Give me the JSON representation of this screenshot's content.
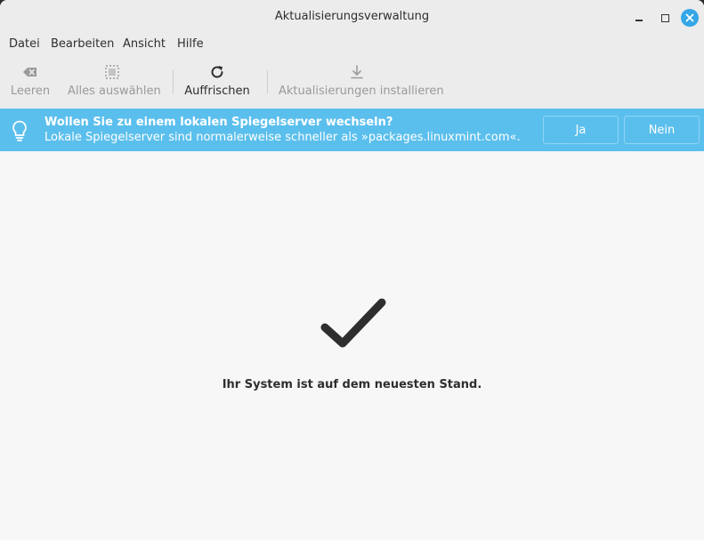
{
  "window": {
    "title": "Aktualisierungsverwaltung",
    "close_color": "#35a6e6"
  },
  "menubar": {
    "items": [
      {
        "label": "Datei"
      },
      {
        "label": "Bearbeiten"
      },
      {
        "label": "Ansicht"
      },
      {
        "label": "Hilfe"
      }
    ]
  },
  "toolbar": {
    "clear_label": "Leeren",
    "select_all_label": "Alles auswählen",
    "refresh_label": "Auffrischen",
    "install_label": "Aktualisierungen installieren"
  },
  "infobar": {
    "title": "Wollen Sie zu einem lokalen Spiegelserver wechseln?",
    "text": "Lokale Spiegelserver sind normalerweise schneller als »packages.linuxmint.com«.",
    "yes_label": "Ja",
    "no_label": "Nein",
    "color": "#5bbfed"
  },
  "main": {
    "status_text": "Ihr System ist auf dem neuesten Stand."
  },
  "icons": {
    "clear": "backspace-icon",
    "select_all": "select-all-icon",
    "refresh": "refresh-icon",
    "install": "download-icon",
    "bulb": "lightbulb-icon",
    "check": "checkmark-icon"
  }
}
